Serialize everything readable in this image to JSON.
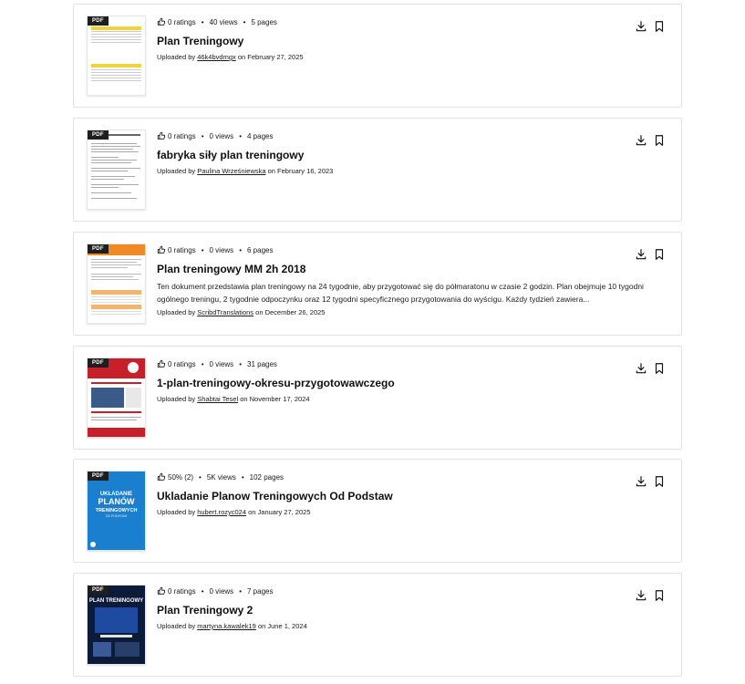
{
  "results": [
    {
      "badge": "PDF",
      "ratings": "0 ratings",
      "views": "40 views",
      "pages": "5 pages",
      "title": "Plan Treningowy",
      "description": "",
      "uploaded_prefix": "Uploaded by",
      "uploader": "46k4bvdmgx",
      "date_text": "on February 27, 2025",
      "thumb_style": "yellow-table"
    },
    {
      "badge": "PDF",
      "ratings": "0 ratings",
      "views": "0 views",
      "pages": "4 pages",
      "title": "fabryka siły plan treningowy",
      "description": "",
      "uploaded_prefix": "Uploaded by",
      "uploader": "Paulina Wrześniewska",
      "date_text": "on February 16, 2023",
      "thumb_style": "text-doc"
    },
    {
      "badge": "PDF",
      "ratings": "0 ratings",
      "views": "0 views",
      "pages": "6 pages",
      "title": "Plan treningowy MM 2h 2018",
      "description": "Ten dokument przedstawia plan treningowy na 24 tygodnie, aby przygotować się do półmaratonu w czasie 2 godzin. Plan obejmuje 10 tygodni ogólnego treningu, 2 tygodnie odpoczynku oraz 12 tygodni specyficznego przygotowania do wyścigu. Każdy tydzień zawiera...",
      "uploaded_prefix": "Uploaded by",
      "uploader": "ScribdTranslations",
      "date_text": "on December 26, 2025",
      "thumb_style": "orange-doc"
    },
    {
      "badge": "PDF",
      "ratings": "0 ratings",
      "views": "0 views",
      "pages": "31 pages",
      "title": "1-plan-treningowy-okresu-przygotowawczego",
      "description": "",
      "uploaded_prefix": "Uploaded by",
      "uploader": "Shabtai Tesel",
      "date_text": "on November 17, 2024",
      "thumb_style": "red-cover"
    },
    {
      "badge": "PDF",
      "ratings": "50% (2)",
      "views": "5K views",
      "pages": "102 pages",
      "title": "Ukladanie Planow Treningowych Od Podstaw",
      "description": "",
      "uploaded_prefix": "Uploaded by",
      "uploader": "hubert.rozyc024",
      "date_text": "on January 27, 2025",
      "thumb_style": "blue-cover",
      "cover_text": [
        "UKŁADANIE",
        "PLANÓW",
        "TRENINGOWYCH",
        "OD PODSTAW"
      ]
    },
    {
      "badge": "PDF",
      "ratings": "0 ratings",
      "views": "0 views",
      "pages": "7 pages",
      "title": "Plan Treningowy 2",
      "description": "",
      "uploaded_prefix": "Uploaded by",
      "uploader": "martyna.kawalek19",
      "date_text": "on June 1, 2024",
      "thumb_style": "dark-cover",
      "cover_text": [
        "PLAN TRENINGOWY"
      ]
    }
  ],
  "icons": {
    "thumb": "thumbs-up-icon",
    "download": "download-icon",
    "bookmark": "bookmark-icon"
  }
}
